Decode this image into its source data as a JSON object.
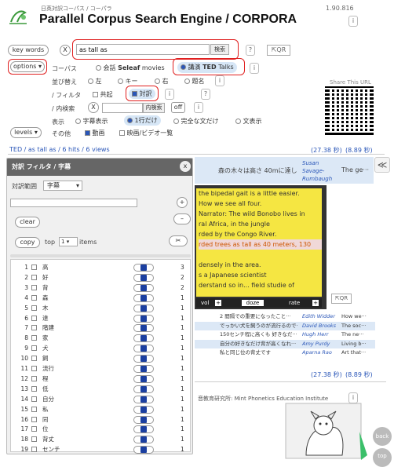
{
  "header": {
    "subtitle": "日英対訳コーパス / コーパラ",
    "title": "Parallel Corpus Search Engine / CORPORA",
    "version": "1.90.816"
  },
  "search": {
    "key_words_label": "key words",
    "x_label": "X",
    "query": "as tall as",
    "search_button": "検索",
    "help": "?",
    "qr": "QR"
  },
  "options": {
    "options_label": "options",
    "corpus_label": "コーパス",
    "corpus_opt1_a": "会話",
    "corpus_opt1_b": "Seleaf",
    "corpus_opt1_c": "movies",
    "corpus_opt2_a": "講演",
    "corpus_opt2_b": "TED",
    "corpus_opt2_c": "Talks",
    "sort_label": "並び替え",
    "sort_left": "左",
    "sort_key": "キー",
    "sort_right": "右",
    "sort_title": "題名",
    "filter_label": "/ フィルタ",
    "filter_cooc": "共起",
    "filter_parallel": "対訳",
    "inner_label": "/ 内検索",
    "inner_x": "X",
    "inner_btn": "内検索",
    "inner_off": "off",
    "display_label": "表示",
    "disp_subtitle": "字幕表示",
    "disp_oneline": "1行だけ",
    "disp_full": "完全な文だけ",
    "disp_context": "文表示",
    "other_label": "その他",
    "other_video": "動画",
    "other_movie": "映画/ビデオ一覧",
    "levels_label": "levels"
  },
  "share": {
    "label": "Share This URL"
  },
  "results": {
    "summary": "TED / as tall as / 6 hits / 6 views",
    "time1": "(27.38 秒)",
    "time2": "(8.89 秒)",
    "footer_time1": "(27.38 秒)",
    "footer_time2": "(8.89 秒)"
  },
  "top_row": {
    "jp": "森の木々は高さ 40mに達し",
    "speaker": "Susan Savage-Rumbaugh",
    "en": "The ge···"
  },
  "rows": [
    {
      "jp": "2 間隔での重要になったこと···",
      "speaker": "Edith Widder",
      "en": "How we···"
    },
    {
      "jp": "でっかい犬を飼うのが流行るので···",
      "speaker": "David Brooks",
      "en": "The soc···"
    },
    {
      "jp": "150センチ程に高くも 好きなだ···",
      "speaker": "Hugh Herr",
      "en": "The ne···"
    },
    {
      "jp": "自分の好きなだけ背が高くなれ···",
      "speaker": "Amy Purdy",
      "en": "Living b···"
    },
    {
      "jp": "私と同じ位の背丈です",
      "speaker": "Aparna Rao",
      "en": "Art that···"
    }
  ],
  "video": {
    "lines": [
      "the bipedal gait is a little easier.",
      "How we see all four.",
      "Narrator: The wild Bonobo lives in",
      "ral Africa, in the jungle",
      "rded by the Congo River.",
      "rded trees as tall as 40 meters, 130",
      "",
      "densely in the area.",
      "s a Japanese scientist",
      "derstand so in... field studie of"
    ],
    "vol": "vol",
    "doze": "doze",
    "rate": "rate",
    "qr": "QR"
  },
  "footer": {
    "credit": "音教育研究所: Mint Phonetics Education Institute",
    "back": "back",
    "top": "top"
  },
  "panel": {
    "title": "対訳 フィルタ / 字幕",
    "close": "x",
    "range_label": "対訳範囲",
    "range_value": "字幕",
    "clear": "clear",
    "copy": "copy",
    "top_label": "top",
    "top_value": "1",
    "items_label": "items",
    "list": [
      {
        "n": "1",
        "w": "高",
        "c": "3"
      },
      {
        "n": "2",
        "w": "好",
        "c": "2"
      },
      {
        "n": "3",
        "w": "背",
        "c": "2"
      },
      {
        "n": "4",
        "w": "森",
        "c": "1"
      },
      {
        "n": "5",
        "w": "木",
        "c": "1"
      },
      {
        "n": "6",
        "w": "達",
        "c": "1"
      },
      {
        "n": "7",
        "w": "階建",
        "c": "1"
      },
      {
        "n": "8",
        "w": "家",
        "c": "1"
      },
      {
        "n": "9",
        "w": "犬",
        "c": "1"
      },
      {
        "n": "10",
        "w": "飼",
        "c": "1"
      },
      {
        "n": "11",
        "w": "流行",
        "c": "1"
      },
      {
        "n": "12",
        "w": "程",
        "c": "1"
      },
      {
        "n": "13",
        "w": "低",
        "c": "1"
      },
      {
        "n": "14",
        "w": "自分",
        "c": "1"
      },
      {
        "n": "15",
        "w": "私",
        "c": "1"
      },
      {
        "n": "16",
        "w": "同",
        "c": "1"
      },
      {
        "n": "17",
        "w": "位",
        "c": "1"
      },
      {
        "n": "18",
        "w": "背丈",
        "c": "1"
      },
      {
        "n": "19",
        "w": "センチ",
        "c": "1"
      }
    ]
  },
  "colors": {
    "accent": "#2a56b8",
    "highlight_red": "#e02020",
    "video_yellow": "#f5e642"
  }
}
